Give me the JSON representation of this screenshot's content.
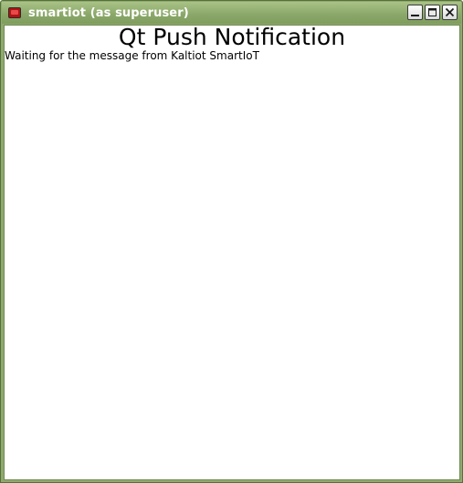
{
  "window": {
    "title": "smartiot (as superuser)",
    "icon": "app-icon",
    "buttons": [
      "minimize-icon",
      "maximize-icon",
      "close-icon"
    ]
  },
  "content": {
    "heading": "Qt Push Notification",
    "status": "Waiting for the message from Kaltiot SmartIoT"
  }
}
